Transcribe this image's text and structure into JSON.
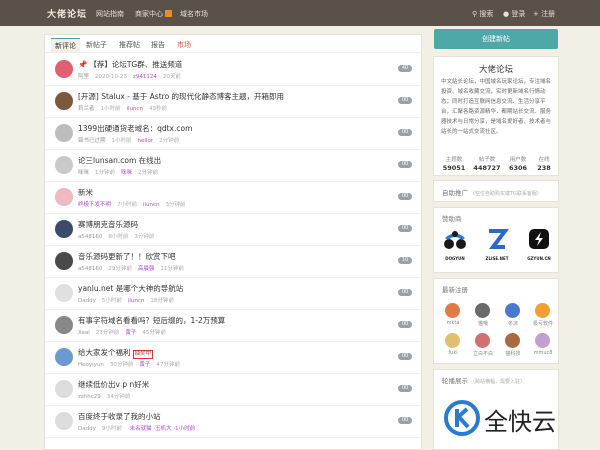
{
  "header": {
    "logo": "大佬论坛",
    "nav": [
      "网站指南",
      "商家中心",
      "域名市场"
    ],
    "search": "搜索",
    "login": "登录",
    "register": "注册"
  },
  "tabs": [
    "新评论",
    "新帖子",
    "推荐帖",
    "报告",
    "市场"
  ],
  "topics": [
    {
      "title": "【荐】论坛TG群、推送频道",
      "pinned": true,
      "user": "阿里",
      "time": "2020-10-23",
      "extra": "z941124",
      "ago": "20天前",
      "count": "40",
      "avatar_color": "#e06070"
    },
    {
      "title": "[开源] Stalux - 基于 Astro 的现代化静态博客主题，开箱即用",
      "user": "莉兰者",
      "time": "1小时前",
      "extra": "iluncn",
      "ago": "49秒前",
      "count": "00",
      "avatar_color": "#7a5a3a"
    },
    {
      "title": "1399出硬通货老域名：qdtx.com",
      "user": "锦书已过期",
      "time": "1小时前",
      "extra": "hellor",
      "ago": "2分钟前",
      "count": "00",
      "avatar_color": "#bdbdbd"
    },
    {
      "title": "论三lunsan.com 在线出",
      "user": "咪咪",
      "time": "1分钟前",
      "extra": "咪咪",
      "ago": "2分钟前",
      "count": "00",
      "avatar_color": "#c9c9c9"
    },
    {
      "title": "新米",
      "user": "终极下发不明",
      "user_purple": true,
      "time": "7小时前",
      "extra": "iluncn",
      "ago": "3分钟前",
      "count": "00",
      "avatar_color": "#f0b8c0"
    },
    {
      "title": "赛博朋克音乐源码",
      "user": "a548160",
      "time": "8小时前",
      "extra": "",
      "ago": "3分钟前",
      "count": "00",
      "avatar_color": "#3a4a6a"
    },
    {
      "title": "音乐源码更新了！！欣赏下吧",
      "user": "a548160",
      "time": "29分钟前",
      "extra": "高晨强",
      "ago": "11分钟前",
      "count": "10",
      "avatar_color": "#4a4a4a"
    },
    {
      "title": "yanlu.net 是哪个大神的导航站",
      "user": "Daddy",
      "time": "5小时前",
      "extra": "iluncn",
      "ago": "18分钟前",
      "count": "00",
      "avatar_color": "#e0e0e0"
    },
    {
      "title": "有事字符域名看看吗？短后缀的，1-2万预算",
      "user": "Xeal",
      "time": "23分钟前",
      "extra": "黄子",
      "ago": "45分钟前",
      "count": "00",
      "avatar_color": "#888"
    },
    {
      "title": "给大家发个福利",
      "tag": "抽奖中",
      "user": "Heoyiyun",
      "time": "30分钟前",
      "extra": "黄子",
      "ago": "47分钟前",
      "count": "00",
      "avatar_color": "#6a9ad0"
    },
    {
      "title": "继续低价出v p n好米",
      "user": "zzhhc29",
      "time": "34分钟前",
      "extra": "",
      "ago": "",
      "count": "00",
      "avatar_color": "#ddd"
    },
    {
      "title": "百度终于收录了我的小站",
      "user": "Daddy",
      "time": "9小时前",
      "extra": "·未名就猫 ·玉机大 ·1小时前",
      "ago": "",
      "count": "00",
      "avatar_color": "#ddd"
    }
  ],
  "sidebar": {
    "create_button": "创建新帖",
    "forum_name": "大佬论坛",
    "forum_desc": "中文站长论坛，中国域名玩家论坛，专注域名投资、域名收藏交流，实时更新域名行情动态；同时打造互联网信息交流、生活分享平台，汇聚各路资源精华，都期站长交流、服务器技术与日常分享，是域名爱好者、技术者与站长的一站式交流社区。",
    "stats": [
      {
        "label": "主题数",
        "value": "59051"
      },
      {
        "label": "帖子数",
        "value": "448727"
      },
      {
        "label": "用户数",
        "value": "6306"
      },
      {
        "label": "在线",
        "value": "238"
      }
    ],
    "promo_title": "自助推广",
    "promo_note": "（空位自助购买或TG联系客服）",
    "sponsors_title": "赞助商",
    "sponsors": [
      "DOGYUN",
      "ZLISE.NET",
      "GZYUN.CN"
    ],
    "members_title": "最新注册",
    "members": [
      {
        "name": "mkta",
        "color": "#e07a4a"
      },
      {
        "name": "猫哦",
        "color": "#6a6a6a"
      },
      {
        "name": "冬凉",
        "color": "#4a7ad0"
      },
      {
        "name": "极亏软件",
        "color": "#f0a030"
      },
      {
        "name": "fuki",
        "color": "#e0c070"
      },
      {
        "name": "立白不白",
        "color": "#d07070"
      },
      {
        "name": "猫科技",
        "color": "#aa6a40"
      },
      {
        "name": "mmuc8",
        "color": "#c0a0d0"
      }
    ],
    "carousel_title": "轮播展示",
    "carousel_note": "（跨站横幅，需要入驻）",
    "carousel_brand": "全快云"
  }
}
